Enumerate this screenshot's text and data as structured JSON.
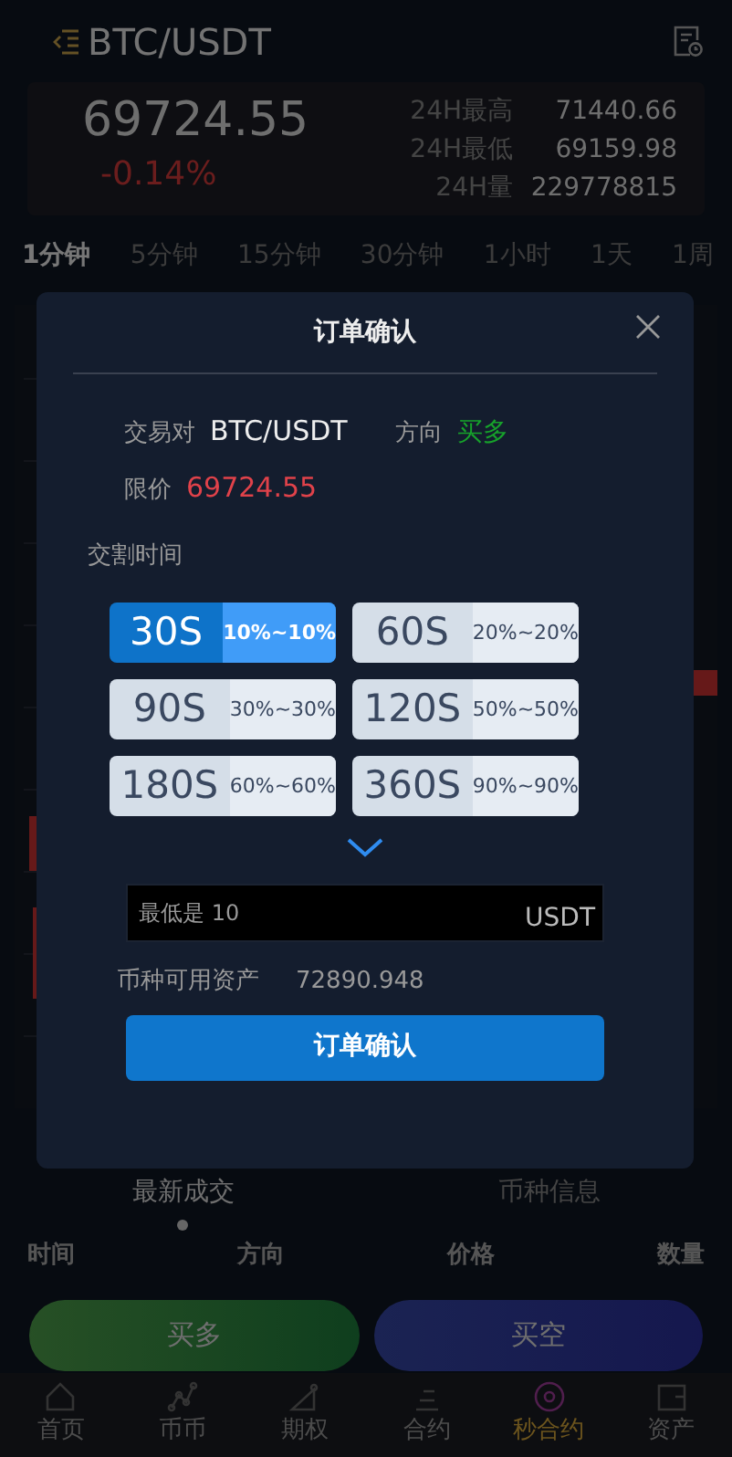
{
  "header": {
    "title": "BTC/USDT"
  },
  "ticker": {
    "price": "69724.55",
    "change": "-0.14%",
    "stats": [
      {
        "label": "24H最高",
        "value": "71440.66"
      },
      {
        "label": "24H最低",
        "value": "69159.98"
      },
      {
        "label": "24H量",
        "value": "229778815"
      }
    ]
  },
  "timeframes": [
    {
      "label": "1分钟",
      "selected": true
    },
    {
      "label": "5分钟",
      "selected": false
    },
    {
      "label": "15分钟",
      "selected": false
    },
    {
      "label": "30分钟",
      "selected": false
    },
    {
      "label": "1小时",
      "selected": false
    },
    {
      "label": "1天",
      "selected": false
    },
    {
      "label": "1周",
      "selected": false
    }
  ],
  "info_tabs": [
    {
      "label": "最新成交",
      "selected": true
    },
    {
      "label": "币种信息",
      "selected": false
    }
  ],
  "trade_columns": [
    "时间",
    "方向",
    "价格",
    "数量"
  ],
  "actions": [
    {
      "label": "买多",
      "kind": "long"
    },
    {
      "label": "买空",
      "kind": "short"
    }
  ],
  "bottom_nav": [
    {
      "label": "首页",
      "selected": false
    },
    {
      "label": "币币",
      "selected": false
    },
    {
      "label": "期权",
      "selected": false
    },
    {
      "label": "合约",
      "selected": false
    },
    {
      "label": "秒合约",
      "selected": true
    },
    {
      "label": "资产",
      "selected": false
    }
  ],
  "modal": {
    "title": "订单确认",
    "pair_label": "交易对",
    "pair": "BTC/USDT",
    "direction_label": "方向",
    "direction": "买多",
    "price_label": "限价",
    "price": "69724.55",
    "section_label": "交割时间",
    "durations": [
      {
        "time": "30S",
        "ratio": "10%~10%",
        "selected": true
      },
      {
        "time": "60S",
        "ratio": "20%~20%",
        "selected": false
      },
      {
        "time": "90S",
        "ratio": "30%~30%",
        "selected": false
      },
      {
        "time": "120S",
        "ratio": "50%~50%",
        "selected": false
      },
      {
        "time": "180S",
        "ratio": "60%~60%",
        "selected": false
      },
      {
        "time": "360S",
        "ratio": "90%~90%",
        "selected": false
      }
    ],
    "amount": {
      "placeholder": "最低是 10",
      "unit": "USDT"
    },
    "balance_label": "币种可用资产",
    "balance": "72890.948",
    "confirm": "订单确认"
  }
}
